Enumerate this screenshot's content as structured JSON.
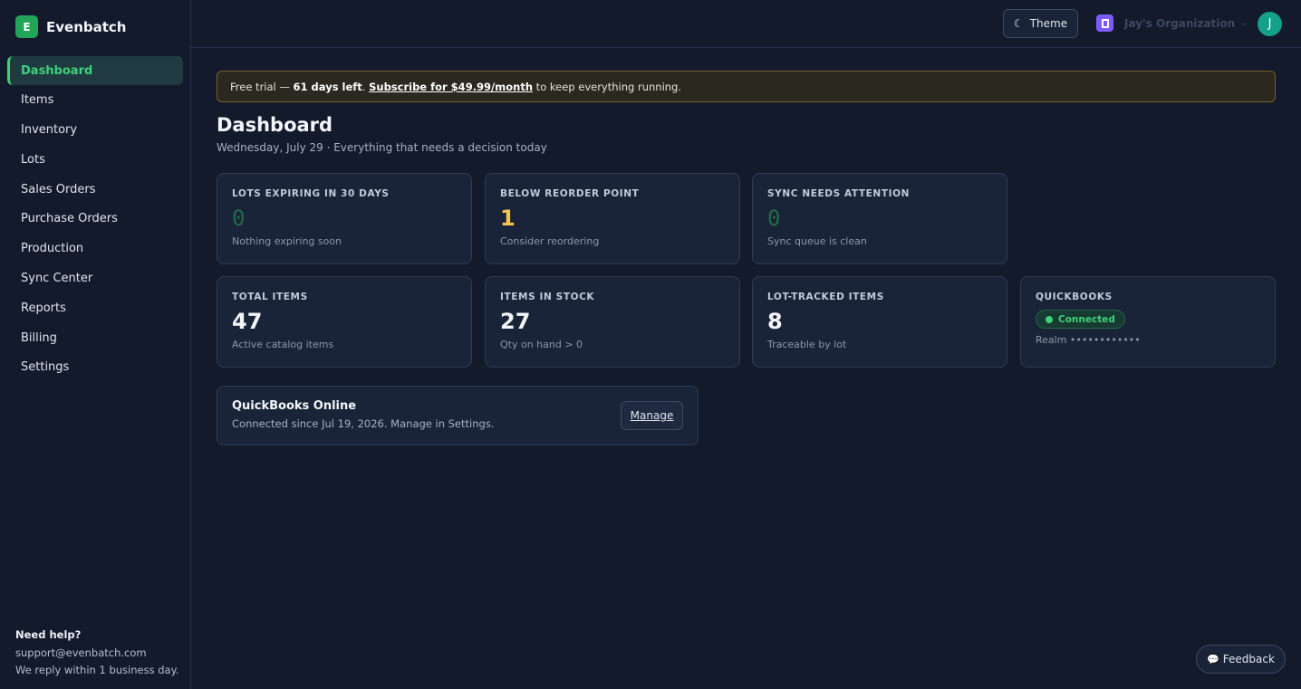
{
  "brand": {
    "logo_letter": "E",
    "name": "Evenbatch"
  },
  "sidebar": {
    "items": [
      {
        "label": "Dashboard",
        "active": true
      },
      {
        "label": "Items"
      },
      {
        "label": "Inventory"
      },
      {
        "label": "Lots"
      },
      {
        "label": "Sales Orders"
      },
      {
        "label": "Purchase Orders"
      },
      {
        "label": "Production"
      },
      {
        "label": "Sync Center"
      },
      {
        "label": "Reports"
      },
      {
        "label": "Billing"
      },
      {
        "label": "Settings"
      }
    ],
    "help": {
      "title": "Need help?",
      "email": "support@evenbatch.com",
      "note": "We reply within 1 business day."
    }
  },
  "topbar": {
    "theme_label": "Theme",
    "org_name": "Jay's Organization",
    "avatar_letter": "J"
  },
  "banner": {
    "prefix": "Free trial — ",
    "days": "61 days left",
    "dot": ". ",
    "link": "Subscribe for $49.99/month",
    "suffix": " to keep everything running."
  },
  "page": {
    "title": "Dashboard",
    "subtitle": "Wednesday, July 29 · Everything that needs a decision today"
  },
  "cards": {
    "lots_expiring": {
      "label": "LOTS EXPIRING IN 30 DAYS",
      "value": "0",
      "note": "Nothing expiring soon"
    },
    "below_reorder": {
      "label": "BELOW REORDER POINT",
      "value": "1",
      "note": "Consider reordering"
    },
    "sync_attention": {
      "label": "SYNC NEEDS ATTENTION",
      "value": "0",
      "note": "Sync queue is clean"
    },
    "total_items": {
      "label": "TOTAL ITEMS",
      "value": "47",
      "note": "Active catalog items"
    },
    "items_in_stock": {
      "label": "ITEMS IN STOCK",
      "value": "27",
      "note": "Qty on hand > 0"
    },
    "lot_tracked": {
      "label": "LOT-TRACKED ITEMS",
      "value": "8",
      "note": "Traceable by lot"
    },
    "quickbooks": {
      "label": "QUICKBOOKS",
      "status": "Connected",
      "realm": "Realm ••••••••••••"
    }
  },
  "qbo": {
    "title": "QuickBooks Online",
    "subtitle": "Connected since Jul 19, 2026. Manage in Settings.",
    "manage_label": "Manage"
  },
  "feedback": {
    "label": "Feedback"
  },
  "colors": {
    "accent": "#3fd07a",
    "warning": "#f4c74d",
    "brand": "#22a55a"
  }
}
